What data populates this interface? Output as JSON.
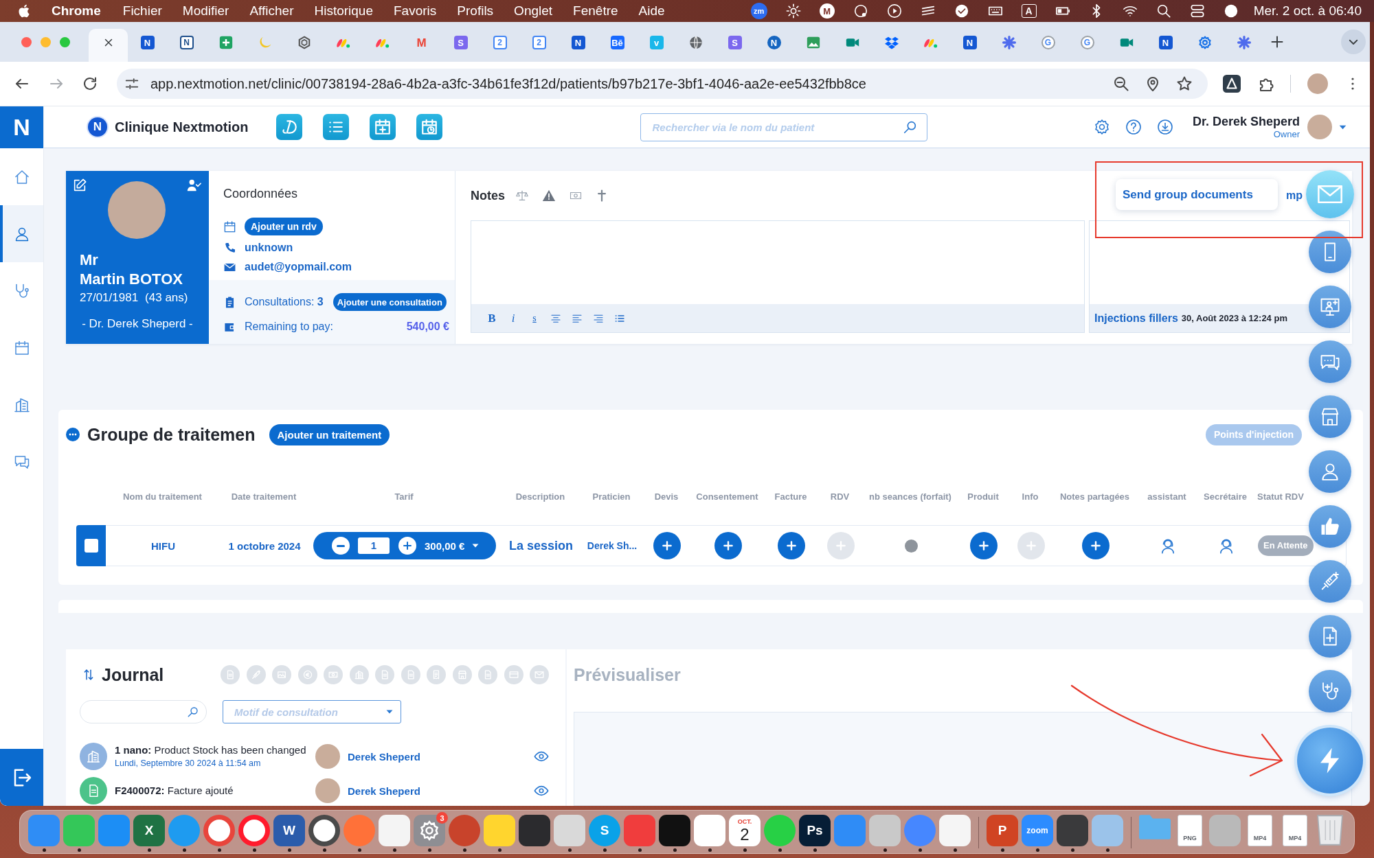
{
  "menu_bar": {
    "app_name": "Chrome",
    "menus": [
      "Fichier",
      "Modifier",
      "Afficher",
      "Historique",
      "Favoris",
      "Profils",
      "Onglet",
      "Fenêtre",
      "Aide"
    ],
    "status_items": [
      {
        "kind": "badge",
        "glyph": "zm"
      },
      {
        "kind": "sun"
      },
      {
        "kind": "ring-letter",
        "glyph": "M"
      },
      {
        "kind": "record"
      },
      {
        "kind": "play"
      },
      {
        "kind": "bars"
      },
      {
        "kind": "check"
      },
      {
        "kind": "keyboard"
      },
      {
        "kind": "boxed-letter",
        "glyph": "A"
      },
      {
        "kind": "battery"
      },
      {
        "kind": "bluetooth"
      },
      {
        "kind": "wifi"
      },
      {
        "kind": "search"
      },
      {
        "kind": "toggles"
      },
      {
        "kind": "orb"
      }
    ],
    "clock": "Mer. 2 oct. à 06:40"
  },
  "browser": {
    "tabs": [
      {
        "selected": true
      },
      {
        "selected": false,
        "kind": "letter",
        "glyph": "N",
        "color": "#1457d2"
      },
      {
        "selected": false,
        "kind": "outline-letter",
        "glyph": "N",
        "color": "#1e4f8c"
      },
      {
        "selected": false,
        "kind": "plus-tile",
        "color": "#1fa463"
      },
      {
        "selected": false,
        "kind": "crescent",
        "color": "#f3c623"
      },
      {
        "selected": false,
        "kind": "knot",
        "color": "#555555"
      },
      {
        "selected": false,
        "kind": "stripes",
        "color": "#ff3d57"
      },
      {
        "selected": false,
        "kind": "stripes",
        "color": "#ff3d57"
      },
      {
        "selected": false,
        "kind": "plain-letter",
        "glyph": "M",
        "color": "#ea4335"
      },
      {
        "selected": false,
        "kind": "letter",
        "glyph": "S",
        "color": "#7b68ee"
      },
      {
        "selected": false,
        "kind": "calendar",
        "glyph": "2",
        "color": "#4285f4"
      },
      {
        "selected": false,
        "kind": "calendar",
        "glyph": "2",
        "color": "#4285f4"
      },
      {
        "selected": false,
        "kind": "letter",
        "glyph": "N",
        "color": "#1457d2"
      },
      {
        "selected": false,
        "kind": "letter",
        "glyph": "Bē",
        "color": "#1769ff"
      },
      {
        "selected": false,
        "kind": "letter",
        "glyph": "v",
        "color": "#1ab7ea"
      },
      {
        "selected": false,
        "kind": "globe",
        "color": "#5f6368"
      },
      {
        "selected": false,
        "kind": "letter",
        "glyph": "S",
        "color": "#7b68ee"
      },
      {
        "selected": false,
        "kind": "circle-letter",
        "glyph": "N",
        "color": "#1565c0"
      },
      {
        "selected": false,
        "kind": "picture",
        "color": "#2e9e5b"
      },
      {
        "selected": false,
        "kind": "camera",
        "color": "#00897b"
      },
      {
        "selected": false,
        "kind": "box",
        "color": "#0061fe"
      },
      {
        "selected": false,
        "kind": "stripes",
        "color": "#ff3d57"
      },
      {
        "selected": false,
        "kind": "letter",
        "glyph": "N",
        "color": "#1457d2"
      },
      {
        "selected": false,
        "kind": "asterisk",
        "color": "#4f6bed"
      },
      {
        "selected": false,
        "kind": "ring-letter",
        "glyph": "G",
        "color": "#4285f4"
      },
      {
        "selected": false,
        "kind": "ring-letter",
        "glyph": "G",
        "color": "#4285f4"
      },
      {
        "selected": false,
        "kind": "camera",
        "color": "#00897b"
      },
      {
        "selected": false,
        "kind": "letter",
        "glyph": "N",
        "color": "#1457d2"
      },
      {
        "selected": false,
        "kind": "gear",
        "color": "#1a73e8"
      },
      {
        "selected": false,
        "kind": "asterisk",
        "color": "#4f6bed"
      }
    ],
    "url": "app.nextmotion.net/clinic/00738194-28a6-4b2a-a3fc-34b61fe3f12d/patients/b97b217e-3bf1-4046-aa2e-ee5432fbb8ce"
  },
  "sidebar": {
    "logo": "N",
    "items": [
      {
        "kind": "home",
        "selected": false
      },
      {
        "kind": "person",
        "selected": true
      },
      {
        "kind": "stethoscope",
        "selected": false
      },
      {
        "kind": "calendar",
        "selected": false
      },
      {
        "kind": "building",
        "selected": false
      },
      {
        "kind": "chat",
        "selected": false
      }
    ]
  },
  "header": {
    "logo": "N",
    "clinic": "Clinique Nextmotion",
    "shortcuts": [
      {
        "kind": "swirl"
      },
      {
        "kind": "list"
      },
      {
        "kind": "calendar-plus"
      },
      {
        "kind": "calendar-clock"
      }
    ],
    "search": {
      "placeholder": "Rechercher via le nom du patient"
    },
    "user": {
      "name": "Dr. Derek Sheperd",
      "role": "Owner"
    }
  },
  "patient": {
    "title": "Mr",
    "name": "Martin BOTOX",
    "birth_date": "27/01/1981",
    "age": "(43 ans)",
    "practitioner": "- Dr. Derek Sheperd -"
  },
  "contact": {
    "heading": "Coordonnées",
    "appointment_button": "Ajouter un rdv",
    "phone": "unknown",
    "email": "audet@yopmail.com",
    "consultations": "Consultations: **3**",
    "consultation_button": "Ajouter une consultation",
    "remaining_label": "Remaining to pay:",
    "remaining_amount": "540,00 €"
  },
  "notes": {
    "title": "Notes",
    "side_heading": "mp",
    "format_buttons": [
      {
        "kind": "bold",
        "glyph": "B"
      },
      {
        "kind": "italic",
        "glyph": "i"
      },
      {
        "kind": "underline",
        "glyph": "s"
      }
    ],
    "last_entry": {
      "title": "Injections fillers",
      "date": "30, Août 2023 à 12:24 pm"
    }
  },
  "fab": {
    "tooltip": "Send group documents",
    "buttons": [
      {
        "kind": "envelope",
        "selected": true
      },
      {
        "kind": "phone",
        "selected": false
      },
      {
        "kind": "monitor",
        "selected": false
      },
      {
        "kind": "chat",
        "selected": false
      },
      {
        "kind": "shop",
        "selected": false
      },
      {
        "kind": "person",
        "selected": false
      },
      {
        "kind": "thumbs-up",
        "selected": false
      },
      {
        "kind": "syringe",
        "selected": false
      },
      {
        "kind": "document-plus",
        "selected": false
      },
      {
        "kind": "stethoscope",
        "selected": false
      },
      {
        "kind": "lightning",
        "selected": false
      }
    ]
  },
  "annotations": [
    {
      "kind": "frame"
    },
    {
      "kind": "arrow"
    }
  ],
  "treatment_group": {
    "title": "Groupe de traitemen",
    "add_button": "Ajouter un traitement",
    "injection_button": "Points d'injection",
    "columns": [
      "Nom du traitement",
      "Date traitement",
      "Tarif",
      "Description",
      "Praticien",
      "Devis",
      "Consentement",
      "Facture",
      "RDV",
      "nb seances (forfait)",
      "Produit",
      "Info",
      "Notes partagées",
      "assistant",
      "Secrétaire",
      "Statut RDV"
    ],
    "rows": [
      {
        "checked": false,
        "name": "HIFU",
        "date": "1 octobre 2024",
        "quantity": "1",
        "price": "300,00 €",
        "description": "La session",
        "practitioner": "Derek Sh...",
        "actions": [
          {
            "kind": "add",
            "disabled": false
          },
          {
            "kind": "add",
            "disabled": false
          },
          {
            "kind": "add",
            "disabled": false
          },
          {
            "kind": "add",
            "disabled": true
          },
          {
            "kind": "dot",
            "disabled": false
          },
          {
            "kind": "add",
            "disabled": false
          },
          {
            "kind": "add",
            "disabled": true
          },
          {
            "kind": "add",
            "disabled": false
          },
          {
            "kind": "staff",
            "disabled": false
          },
          {
            "kind": "staff",
            "disabled": false
          }
        ],
        "status": "En Attente"
      }
    ]
  },
  "journal": {
    "title": "Journal",
    "filters": [
      {
        "kind": "document"
      },
      {
        "kind": "syringe"
      },
      {
        "kind": "picture"
      },
      {
        "kind": "coin"
      },
      {
        "kind": "banknote"
      },
      {
        "kind": "building"
      },
      {
        "kind": "document"
      },
      {
        "kind": "document"
      },
      {
        "kind": "invoice"
      },
      {
        "kind": "shop"
      },
      {
        "kind": "document"
      },
      {
        "kind": "card"
      },
      {
        "kind": "envelope"
      }
    ],
    "motif": {
      "placeholder": "Motif de consultation"
    },
    "entries": [
      {
        "kind": "stock",
        "color": "#8fb3e0",
        "text": "**1 nano:** Product Stock has been changed",
        "date": "Lundi, Septembre 30 2024 à 11:54 am",
        "author": "Derek Sheperd"
      },
      {
        "kind": "invoice",
        "color": "#4cc38a",
        "text": "**F2400072:** Facture ajouté",
        "author": "Derek Sheperd"
      }
    ]
  },
  "preview": {
    "title": "Prévisualiser"
  },
  "dock": {
    "sections": [
      {
        "items": [
          {
            "kind": "tile",
            "color": "#2f8df5",
            "running": true
          },
          {
            "kind": "tile",
            "color": "#34c759",
            "running": true
          },
          {
            "kind": "tile",
            "color": "#1c8ef5",
            "running": false
          },
          {
            "kind": "tile",
            "color": "#1f7244",
            "glyph": "X",
            "running": true
          },
          {
            "kind": "round",
            "color": "#1e9bf0",
            "running": true
          },
          {
            "kind": "ring",
            "color": "#e8453c",
            "running": true
          },
          {
            "kind": "ring",
            "color": "#ff1b2d",
            "running": true
          },
          {
            "kind": "tile",
            "color": "#2b5cab",
            "glyph": "W",
            "running": true
          },
          {
            "kind": "ring",
            "color": "#4a4a4a",
            "running": true
          },
          {
            "kind": "round",
            "color": "#ff7139",
            "running": true
          },
          {
            "kind": "tile",
            "color": "#f4f4f4",
            "running": true
          },
          {
            "kind": "gear",
            "color": "#8e8e93",
            "badge": "3",
            "running": true
          },
          {
            "kind": "round",
            "color": "#c8432b",
            "running": true
          },
          {
            "kind": "tile",
            "color": "#ffd52e",
            "running": true
          },
          {
            "kind": "tile",
            "color": "#2b2b2e",
            "running": false
          },
          {
            "kind": "tile",
            "color": "#d9d9d9",
            "running": true
          },
          {
            "kind": "round",
            "color": "#0aa2e8",
            "glyph": "S",
            "running": true
          },
          {
            "kind": "tile",
            "color": "#f03d3d",
            "running": true
          },
          {
            "kind": "tile",
            "color": "#111111",
            "running": true
          },
          {
            "kind": "tile",
            "color": "#ffffff",
            "running": true
          },
          {
            "kind": "calendar",
            "month": "OCT.",
            "day": "2",
            "running": true
          },
          {
            "kind": "round",
            "color": "#27d045",
            "running": true
          },
          {
            "kind": "tile",
            "color": "#061e36",
            "glyph": "Ps",
            "running": true
          },
          {
            "kind": "tile",
            "color": "#2f8cf6",
            "running": false
          },
          {
            "kind": "tile",
            "color": "#c9c9c9",
            "running": true
          },
          {
            "kind": "round",
            "color": "#4687ff",
            "running": true
          },
          {
            "kind": "tile",
            "color": "#f5f5f5",
            "running": true
          }
        ]
      },
      {
        "items": [
          {
            "kind": "tile",
            "color": "#d04423",
            "glyph": "P",
            "running": true
          },
          {
            "kind": "tile",
            "color": "#2d8cff",
            "glyph": "zoom",
            "running": true
          },
          {
            "kind": "tile",
            "color": "#3a3a3c",
            "running": true
          },
          {
            "kind": "tile",
            "color": "#9bc3ea",
            "running": true
          }
        ]
      },
      {
        "items": [
          {
            "kind": "folder",
            "color": "#5bb2ef",
            "running": false
          },
          {
            "kind": "document",
            "glyph": "PNG",
            "running": false
          },
          {
            "kind": "tile",
            "color": "#b9b9b9",
            "running": false
          },
          {
            "kind": "document",
            "glyph": "MP4",
            "running": false
          },
          {
            "kind": "document",
            "glyph": "MP4",
            "running": false
          },
          {
            "kind": "trash",
            "running": false
          }
        ]
      }
    ]
  }
}
